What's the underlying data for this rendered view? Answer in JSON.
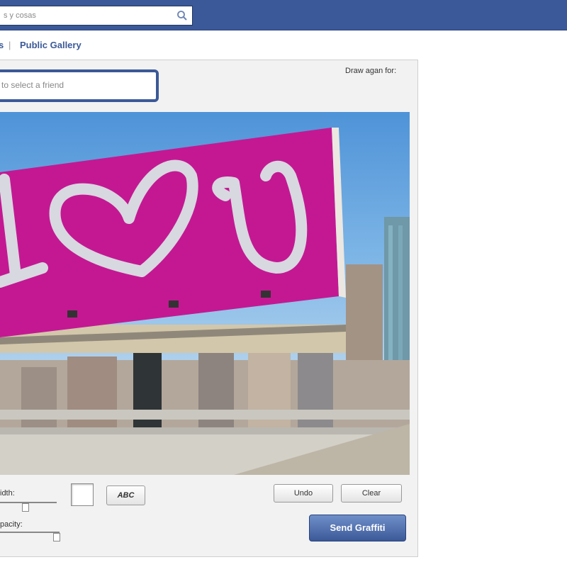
{
  "header": {
    "search_placeholder": "s y cosas"
  },
  "links": {
    "previous_fragment": "s",
    "separator": "|",
    "public_gallery": "Public Gallery"
  },
  "panel": {
    "friend_placeholder": "to select a friend",
    "draw_again_label": "Draw agan for:",
    "billboard_text": "I ♥ U"
  },
  "controls": {
    "width_label": "idth:",
    "opacity_label": "pacity:",
    "text_tool_label": "ABC",
    "undo_label": "Undo",
    "clear_label": "Clear",
    "send_label": "Send Graffiti",
    "width_level": 0.45,
    "opacity_level": 0.95
  },
  "colors": {
    "facebook_blue": "#3b5998",
    "billboard_magenta": "#cc1a9a",
    "paint_color": "#d8d8e0"
  }
}
